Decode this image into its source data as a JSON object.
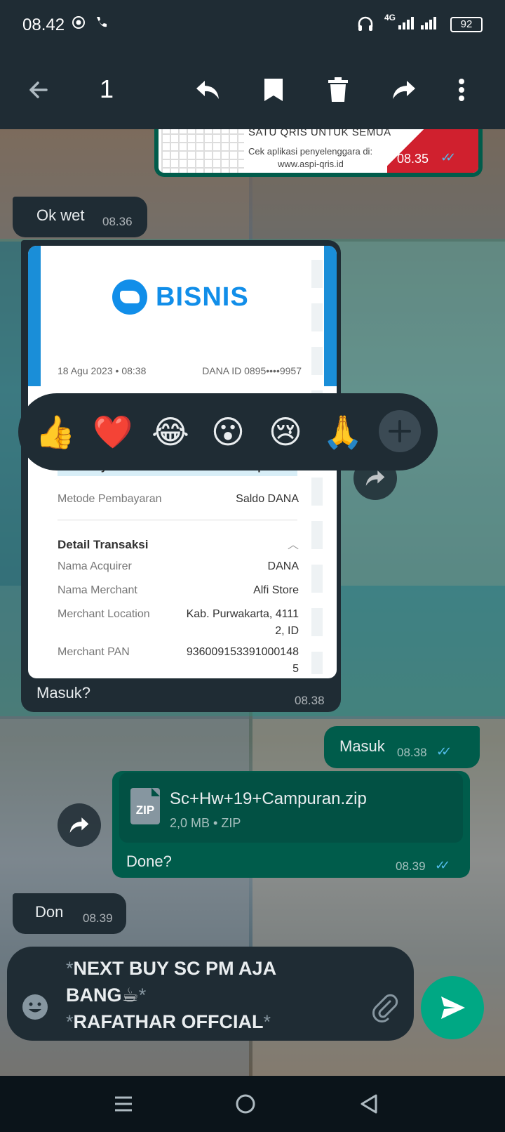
{
  "status_bar": {
    "time": "08.42",
    "network": "4G",
    "battery": "92"
  },
  "selection_toolbar": {
    "selected_count": "1",
    "icons": [
      "back-arrow-icon",
      "reply-icon",
      "star-icon",
      "delete-icon",
      "forward-icon",
      "more-icon"
    ]
  },
  "messages": {
    "qris": {
      "line1": "SATU QRIS UNTUK SEMUA",
      "line2": "Cek aplikasi penyelenggara di:",
      "line3": "www.aspi-qris.id",
      "time": "08.35"
    },
    "ok_wet": {
      "text": "Ok wet",
      "time": "08.36"
    },
    "receipt": {
      "brand": "BISNIS",
      "date": "18 Agu 2023 • 08:38",
      "dana_id": "DANA ID 0895••••9957",
      "total_label": "Total Bayar",
      "total_value": "Rp10.000",
      "method_label": "Metode Pembayaran",
      "method_value": "Saldo DANA",
      "detail_heading": "Detail Transaksi",
      "acquirer_label": "Nama Acquirer",
      "acquirer_value": "DANA",
      "merchant_label": "Nama Merchant",
      "merchant_value": "Alfi Store",
      "location_label": "Merchant Location",
      "location_value_1": "Kab. Purwakarta, 4111",
      "location_value_2": "2, ID",
      "pan_label": "Merchant PAN",
      "pan_value_1": "936009153391000148",
      "pan_value_2": "5",
      "caption": "Masuk?",
      "time": "08.38"
    },
    "masuk": {
      "text": "Masuk",
      "time": "08.38"
    },
    "file": {
      "name": "Sc+Hw+19+Campuran.zip",
      "meta": "2,0 MB • ZIP",
      "icon_label": "ZIP",
      "caption": "Done?",
      "time": "08.39"
    },
    "don": {
      "text": "Don",
      "time": "08.39"
    }
  },
  "reactions": {
    "emojis": [
      "👍",
      "❤️",
      "😂",
      "😮",
      "😢",
      "🙏"
    ]
  },
  "composer": {
    "line1_mark": "*",
    "line1": "NEXT BUY SC PM AJA",
    "line2": "BANG☕",
    "line2_mark": "*",
    "line3_mark": "*",
    "line3": "RAFATHAR OFFCIAL",
    "line3_end_mark": "*"
  },
  "colors": {
    "header_bg": "#1f2c34",
    "outgoing_bubble": "#005c4b",
    "incoming_bubble": "#1f2c34",
    "accent": "#00a884",
    "read_ticks": "#53bdeb"
  }
}
